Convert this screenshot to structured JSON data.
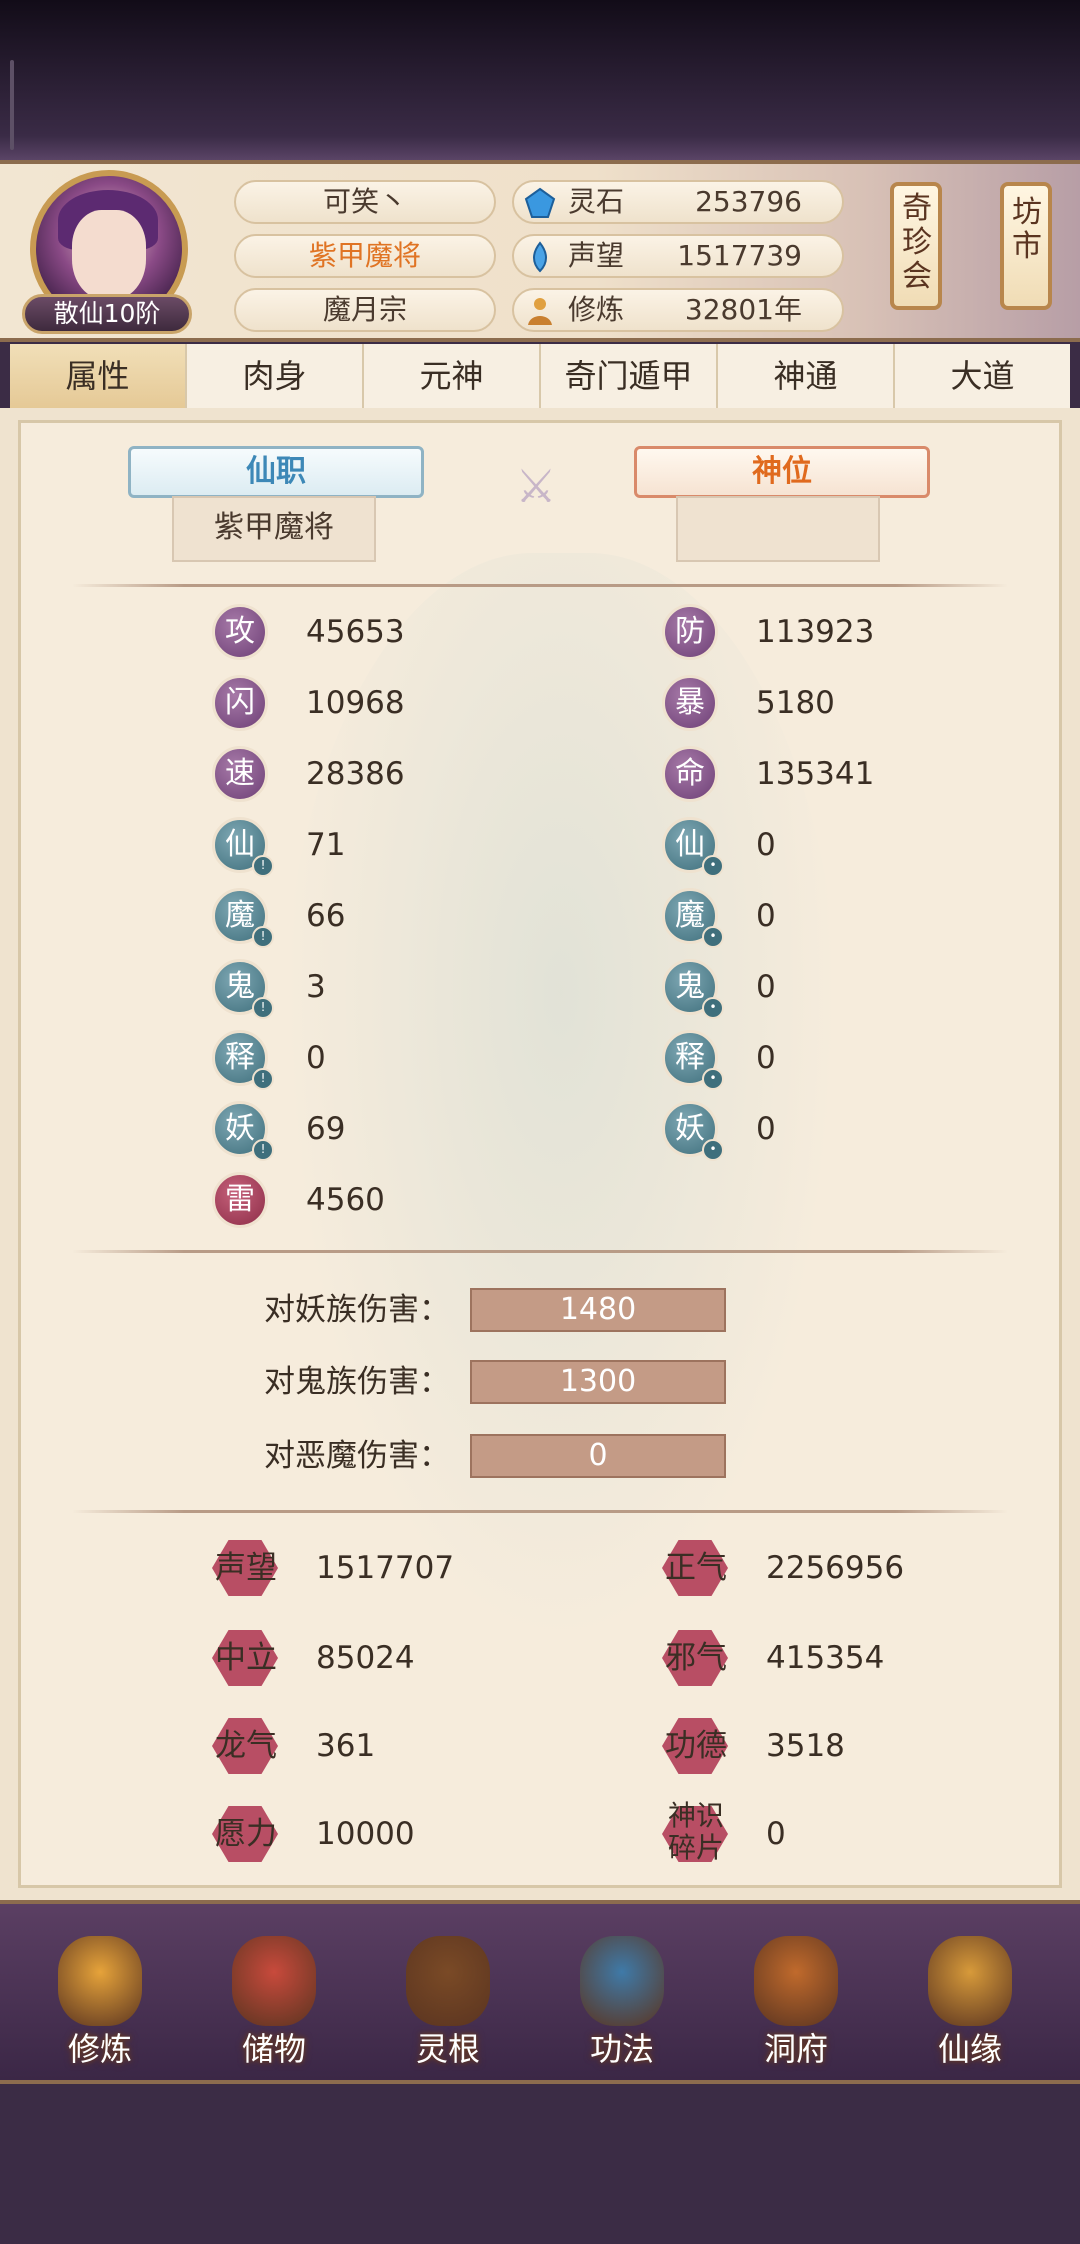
{
  "player": {
    "name": "可笑丶",
    "title": "紫甲魔将",
    "sect": "魔月宗",
    "rank": "散仙10阶"
  },
  "resources": [
    {
      "label": "灵石",
      "value": "253796",
      "icon": "spirit-stone-icon",
      "color": "#3a98e0"
    },
    {
      "label": "声望",
      "value": "1517739",
      "icon": "prestige-icon",
      "color": "#4aa3e6"
    },
    {
      "label": "修炼",
      "value": "32801年",
      "icon": "cultivate-icon",
      "color": "#e0a040"
    }
  ],
  "side_buttons": {
    "treasure": "奇珍会",
    "market": "坊市"
  },
  "tabs": [
    "属性",
    "肉身",
    "元神",
    "奇门遁甲",
    "神通",
    "大道"
  ],
  "active_tab": "属性",
  "positions": {
    "xian_label": "仙职",
    "xian_value": "紫甲魔将",
    "shen_label": "神位",
    "shen_value": ""
  },
  "stats_left": [
    {
      "glyph": "攻",
      "value": "45653"
    },
    {
      "glyph": "闪",
      "value": "10968"
    },
    {
      "glyph": "速",
      "value": "28386"
    },
    {
      "glyph": "仙",
      "value": "71"
    },
    {
      "glyph": "魔",
      "value": "66"
    },
    {
      "glyph": "鬼",
      "value": "3"
    },
    {
      "glyph": "释",
      "value": "0"
    },
    {
      "glyph": "妖",
      "value": "69"
    },
    {
      "glyph": "雷",
      "value": "4560"
    }
  ],
  "stats_right": [
    {
      "glyph": "防",
      "value": "113923"
    },
    {
      "glyph": "暴",
      "value": "5180"
    },
    {
      "glyph": "命",
      "value": "135341"
    },
    {
      "glyph": "仙",
      "value": "0"
    },
    {
      "glyph": "魔",
      "value": "0"
    },
    {
      "glyph": "鬼",
      "value": "0"
    },
    {
      "glyph": "释",
      "value": "0"
    },
    {
      "glyph": "妖",
      "value": "0"
    }
  ],
  "damage": [
    {
      "label": "对妖族伤害：",
      "value": "1480"
    },
    {
      "label": "对鬼族伤害：",
      "value": "1300"
    },
    {
      "label": "对恶魔伤害：",
      "value": "0"
    }
  ],
  "attributes": [
    {
      "label": "声望",
      "value": "1517707"
    },
    {
      "label": "正气",
      "value": "2256956"
    },
    {
      "label": "中立",
      "value": "85024"
    },
    {
      "label": "邪气",
      "value": "415354"
    },
    {
      "label": "龙气",
      "value": "361"
    },
    {
      "label": "功德",
      "value": "3518"
    },
    {
      "label": "愿力",
      "value": "10000"
    },
    {
      "label": "神识碎片",
      "value": "0"
    }
  ],
  "bottom_nav": [
    {
      "label": "修炼",
      "icon": "meditation-icon"
    },
    {
      "label": "储物",
      "icon": "storage-bag-icon"
    },
    {
      "label": "灵根",
      "icon": "spirit-root-icon"
    },
    {
      "label": "功法",
      "icon": "scroll-book-icon"
    },
    {
      "label": "洞府",
      "icon": "cave-dwelling-icon"
    },
    {
      "label": "仙缘",
      "icon": "gourd-icon"
    }
  ]
}
